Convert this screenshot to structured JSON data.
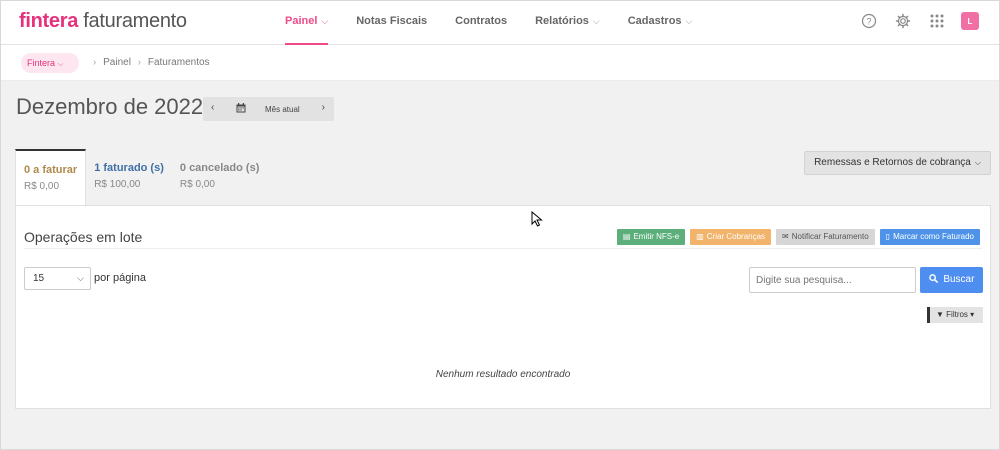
{
  "brand": {
    "name_bold": "fintera",
    "name_rest": "faturamento"
  },
  "nav": {
    "items": [
      {
        "label": "Painel",
        "has_caret": true,
        "active": true
      },
      {
        "label": "Notas Fiscais",
        "has_caret": false,
        "active": false
      },
      {
        "label": "Contratos",
        "has_caret": false,
        "active": false
      },
      {
        "label": "Relatórios",
        "has_caret": true,
        "active": false
      },
      {
        "label": "Cadastros",
        "has_caret": true,
        "active": false
      }
    ]
  },
  "top_icons": [
    "help-circle-icon",
    "gear-icon",
    "apps-grid-icon"
  ],
  "avatar": {
    "initial": "L",
    "color": "#f06fa5"
  },
  "breadcrumb": {
    "org": "Fintera",
    "items": [
      "Painel",
      "Faturamentos"
    ]
  },
  "period": {
    "title": "Dezembro de 2022",
    "current_label": "Mês atual"
  },
  "tabs": [
    {
      "label": "0 a faturar",
      "value": "R$ 0,00"
    },
    {
      "label": "1 faturado (s)",
      "value": "R$ 100,00"
    },
    {
      "label": "0 cancelado (s)",
      "value": "R$ 0,00"
    }
  ],
  "remessas_button": "Remessas e Retornos de cobrança",
  "panel": {
    "title": "Operações em lote",
    "actions": {
      "emitir": "Emitir NFS-e",
      "criar": "Criar Cobranças",
      "notificar": "Notificar Faturamento",
      "marcar": "Marcar como Faturado"
    },
    "per_page_value": "15",
    "per_page_label": "por página",
    "search_placeholder": "Digite sua pesquisa...",
    "search_button": "Buscar",
    "filters_button": "Filtros",
    "empty_message": "Nenhum resultado encontrado"
  },
  "colors": {
    "accent_pink": "#e8317c",
    "action_green": "#5cae7a",
    "action_orange": "#f2b36b",
    "action_gray": "#d6d6d6",
    "action_blue": "#4e93e8",
    "search_blue": "#4d8ef0"
  }
}
